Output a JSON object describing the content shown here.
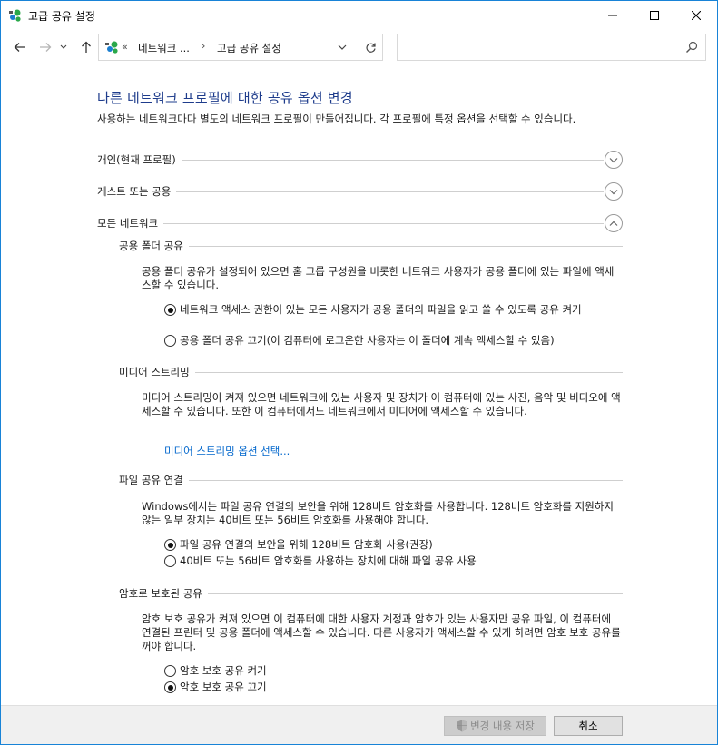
{
  "window": {
    "title": "고급 공유 설정"
  },
  "address": {
    "overflow": "«",
    "crumb1": "네트워크 ...",
    "separator": "›",
    "crumb2": "고급 공유 설정",
    "search_placeholder": ""
  },
  "page": {
    "heading": "다른 네트워크 프로필에 대한 공유 옵션 변경",
    "intro": "사용하는 네트워크마다 별도의 네트워크 프로필이 만들어집니다. 각 프로필에 특정 옵션을 선택할 수 있습니다."
  },
  "sections": {
    "private": {
      "label": "개인(현재 프로필)",
      "expanded": false
    },
    "guest": {
      "label": "게스트 또는 공용",
      "expanded": false
    },
    "all": {
      "label": "모든 네트워크",
      "expanded": true
    }
  },
  "public_folder": {
    "title": "공용 폴더 공유",
    "desc": "공용 폴더 공유가 설정되어 있으면 홈 그룹 구성원을 비롯한 네트워크 사용자가 공용 폴더에 있는 파일에 액세스할 수 있습니다.",
    "opt_on": "네트워크 액세스 권한이 있는 모든 사용자가 공용 폴더의 파일을 읽고 쓸 수 있도록 공유 켜기",
    "opt_off": "공용 폴더 공유 끄기(이 컴퓨터에 로그온한 사용자는 이 폴더에 계속 액세스할 수 있음)",
    "selected": "on"
  },
  "media": {
    "title": "미디어 스트리밍",
    "desc": "미디어 스트리밍이 켜져 있으면 네트워크에 있는 사용자 및 장치가 이 컴퓨터에 있는 사진, 음악 및 비디오에 액세스할 수 있습니다. 또한 이 컴퓨터에서도 네트워크에서 미디어에 액세스할 수 있습니다.",
    "link": "미디어 스트리밍 옵션 선택..."
  },
  "file_sharing": {
    "title": "파일 공유 연결",
    "desc": "Windows에서는 파일 공유 연결의 보안을 위해 128비트 암호화를 사용합니다. 128비트 암호화를 지원하지 않는 일부 장치는 40비트 또는 56비트 암호화를 사용해야 합니다.",
    "opt_128": "파일 공유 연결의 보안을 위해 128비트 암호화 사용(권장)",
    "opt_40": "40비트 또는 56비트 암호화를 사용하는 장치에 대해 파일 공유 사용",
    "selected": "128"
  },
  "password": {
    "title": "암호로 보호된 공유",
    "desc": "암호 보호 공유가 켜져 있으면 이 컴퓨터에 대한 사용자 계정과 암호가 있는 사용자만 공유 파일, 이 컴퓨터에 연결된 프린터 및 공용 폴더에 액세스할 수 있습니다. 다른 사용자가 액세스할 수 있게 하려면 암호 보호 공유를 꺼야 합니다.",
    "opt_on": "암호 보호 공유 켜기",
    "opt_off": "암호 보호 공유 끄기",
    "selected": "off"
  },
  "footer": {
    "save": "변경 내용 저장",
    "cancel": "취소"
  },
  "colors": {
    "heading": "#1e3c8c",
    "link": "#0066cc",
    "window_border": "#1883d7"
  }
}
